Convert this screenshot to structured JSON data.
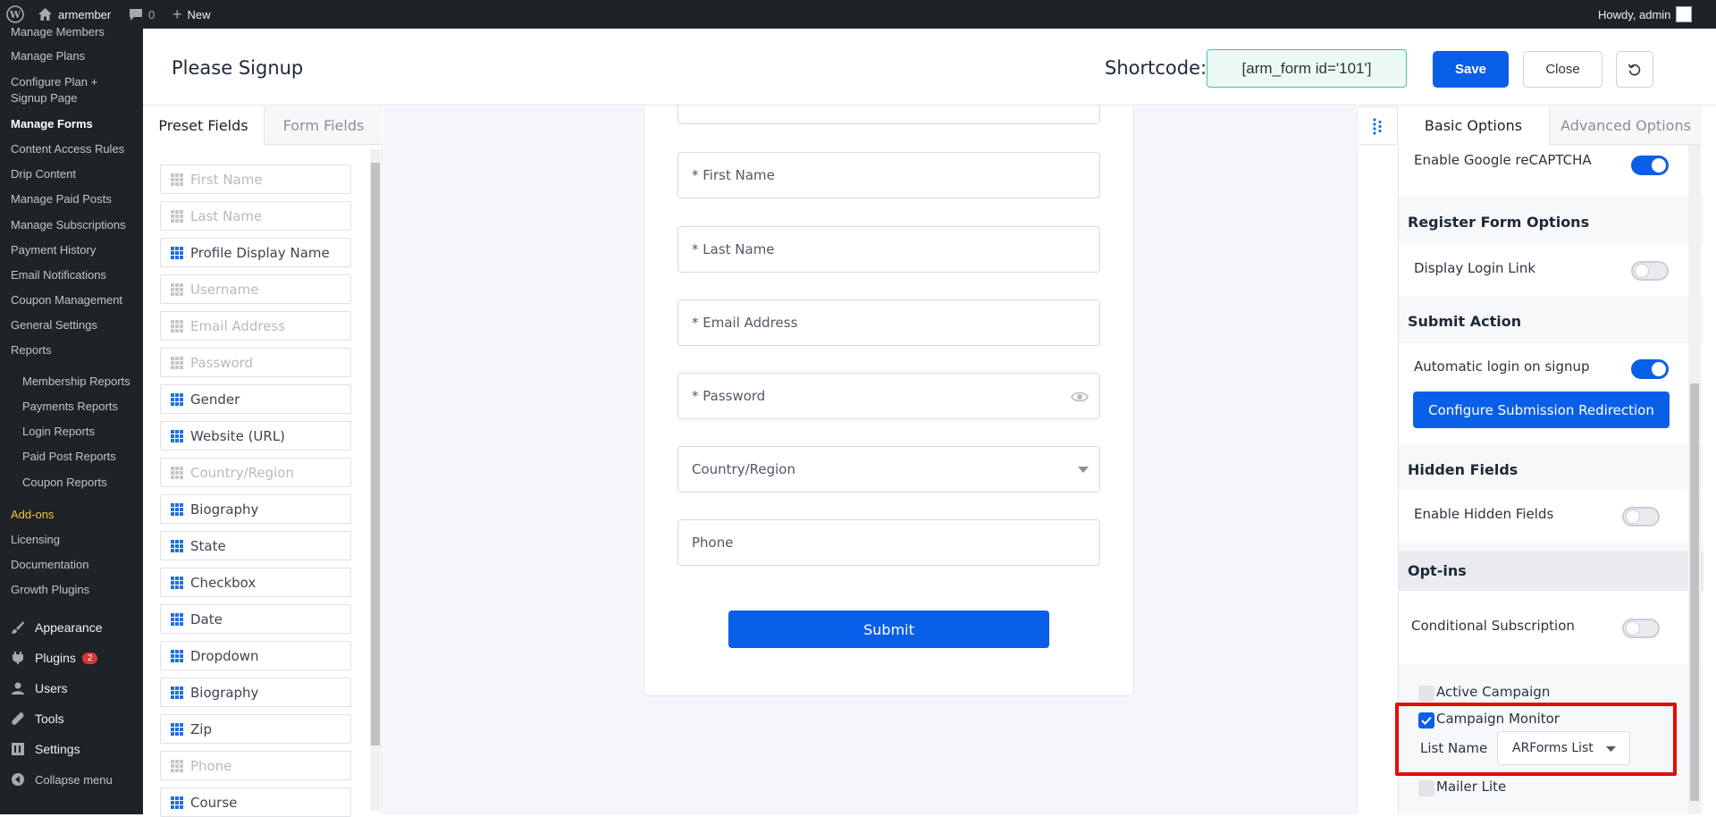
{
  "admin_bar": {
    "site_name": "armember",
    "comments_count": "0",
    "new_label": "New",
    "greeting": "Howdy, admin"
  },
  "admin_menu": {
    "items": [
      "Manage Members",
      "Manage Plans",
      "Configure Plan +",
      "Signup Page",
      "Manage Forms",
      "Content Access Rules",
      "Drip Content",
      "Manage Paid Posts",
      "Manage Subscriptions",
      "Payment History",
      "Email Notifications",
      "Coupon Management",
      "General Settings",
      "Reports"
    ],
    "report_items": [
      "Membership Reports",
      "Payments Reports",
      "Login Reports",
      "Paid Post Reports",
      "Coupon Reports"
    ],
    "extra_items": [
      "Add-ons",
      "Licensing",
      "Documentation",
      "Growth Plugins"
    ],
    "wp_items": [
      "Appearance",
      "Plugins",
      "Users",
      "Tools",
      "Settings"
    ],
    "plugins_badge": "2",
    "collapse_label": "Collapse menu"
  },
  "header": {
    "title": "Please Signup",
    "shortcode_label": "Shortcode:",
    "shortcode_value": "[arm_form id='101']",
    "save_label": "Save",
    "close_label": "Close"
  },
  "left_panel": {
    "tabs": [
      "Preset Fields",
      "Form Fields"
    ],
    "fields": [
      {
        "label": "First Name",
        "used": true
      },
      {
        "label": "Last Name",
        "used": true
      },
      {
        "label": "Profile Display Name",
        "used": false
      },
      {
        "label": "Username",
        "used": true
      },
      {
        "label": "Email Address",
        "used": true
      },
      {
        "label": "Password",
        "used": true
      },
      {
        "label": "Gender",
        "used": false
      },
      {
        "label": "Website (URL)",
        "used": false
      },
      {
        "label": "Country/Region",
        "used": true
      },
      {
        "label": "Biography",
        "used": false
      },
      {
        "label": "State",
        "used": false
      },
      {
        "label": "Checkbox",
        "used": false
      },
      {
        "label": "Date",
        "used": false
      },
      {
        "label": "Dropdown",
        "used": false
      },
      {
        "label": "Biography",
        "used": false
      },
      {
        "label": "Zip",
        "used": false
      },
      {
        "label": "Phone",
        "used": true
      },
      {
        "label": "Course",
        "used": false
      }
    ]
  },
  "form": {
    "inputs": [
      "* First Name",
      "* Last Name",
      "* Email Address",
      "* Password",
      "Country/Region",
      "Phone"
    ],
    "submit_label": "Submit"
  },
  "right_panel": {
    "tabs": [
      "Basic Options",
      "Advanced Options"
    ],
    "recaptcha_label": "Enable Google reCAPTCHA",
    "register_section": "Register Form Options",
    "display_login_label": "Display Login Link",
    "submit_section": "Submit Action",
    "auto_login_label": "Automatic login on signup",
    "configure_redirect_label": "Configure Submission Redirection",
    "hidden_section": "Hidden Fields",
    "enable_hidden_label": "Enable Hidden Fields",
    "optins_section": "Opt-ins",
    "conditional_label": "Conditional Subscription",
    "optins": [
      {
        "label": "Active Campaign",
        "checked": false
      },
      {
        "label": "Campaign Monitor",
        "checked": true
      },
      {
        "label": "Mailer Lite",
        "checked": false
      }
    ],
    "list_name_label": "List Name",
    "list_name_value": "ARForms List"
  },
  "colors": {
    "accent": "#0a5fe8",
    "highlight": "#e10c0c",
    "admin_bg": "#1d2327"
  }
}
